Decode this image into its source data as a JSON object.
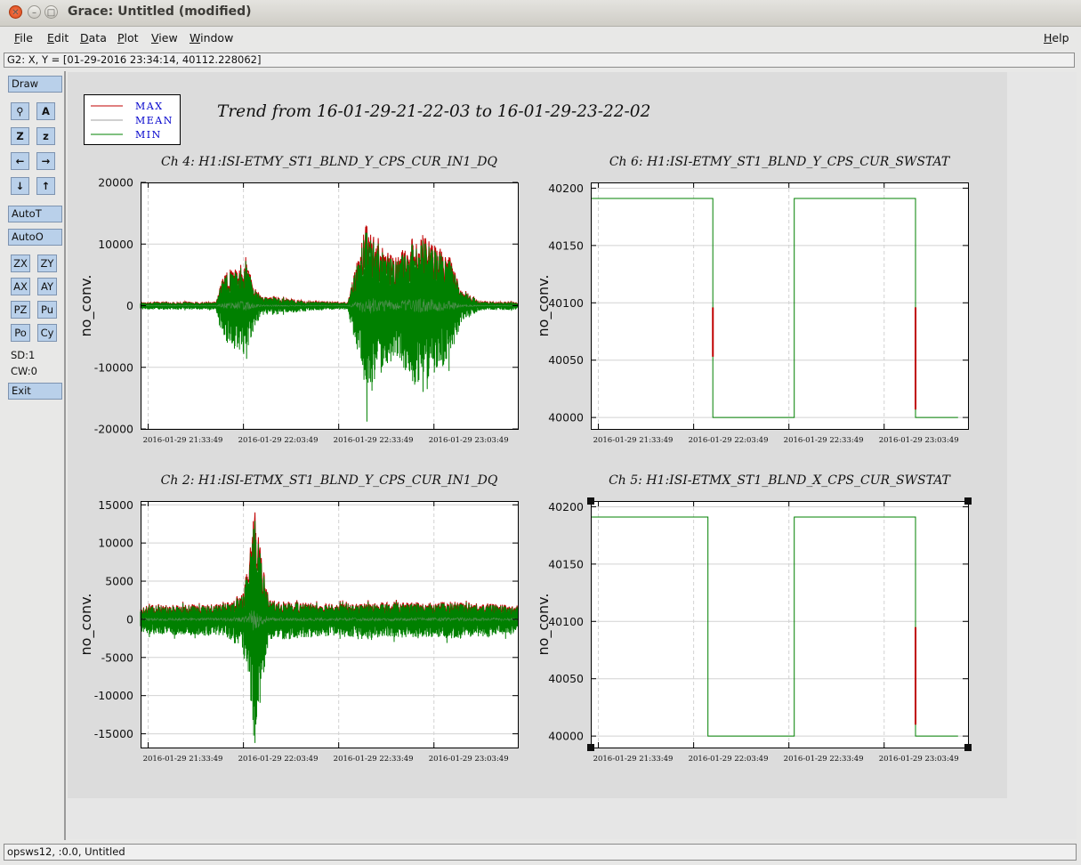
{
  "window": {
    "title": "Grace: Untitled (modified)",
    "close_glyph": "✕",
    "min_glyph": "–",
    "max_glyph": "□"
  },
  "menubar": {
    "items": [
      "File",
      "Edit",
      "Data",
      "Plot",
      "View",
      "Window"
    ],
    "help": "Help"
  },
  "locator": {
    "text": "G2: X, Y = [01-29-2016 23:34:14, 40112.228062]"
  },
  "toolbar": {
    "draw": "Draw",
    "icons": [
      "magnifier-icon",
      "text-zoom-icon",
      "zoom-z-icon",
      "zoom-z-small-icon",
      "arrow-left-icon",
      "arrow-right-icon",
      "arrow-down-icon",
      "arrow-up-icon"
    ],
    "icon_glyphs": [
      "⚲",
      "A",
      "Z",
      "z",
      "←",
      "→",
      "↓",
      "↑"
    ],
    "autot": "AutoT",
    "autoo": "AutoO",
    "small": [
      "ZX",
      "ZY",
      "AX",
      "AY",
      "PZ",
      "Pu",
      "Po",
      "Cy"
    ],
    "sd": "SD:1",
    "cw": "CW:0",
    "exit": "Exit"
  },
  "status": {
    "text": "opsws12, :0.0, Untitled"
  },
  "page": {
    "main_title": "Trend from 16-01-29-21-22-03 to 16-01-29-23-22-02",
    "legend": [
      {
        "label": "MAX",
        "color": "#c00000"
      },
      {
        "label": "MEAN",
        "color": "#a0a0a0"
      },
      {
        "label": "MIN",
        "color": "#008000"
      }
    ],
    "label_color": "#0000cc"
  },
  "chart_data": [
    {
      "type": "line",
      "title": "Ch 4: H1:ISI-ETMY_ST1_BLND_Y_CPS_CUR_IN1_DQ",
      "ylabel": "no_conv.",
      "ylim": [
        -20000,
        20000
      ],
      "yticks": [
        -20000,
        -10000,
        0,
        10000,
        20000
      ],
      "xtick_labels": [
        "2016-01-29 21:33:49",
        "2016-01-29 22:03:49",
        "2016-01-29 22:33:49",
        "2016-01-29 23:03:49"
      ],
      "grid": true,
      "profile": [
        [
          0,
          600
        ],
        [
          0.2,
          600
        ],
        [
          0.22,
          5000
        ],
        [
          0.28,
          8000
        ],
        [
          0.3,
          3500
        ],
        [
          0.32,
          1500
        ],
        [
          0.36,
          1300
        ],
        [
          0.46,
          700
        ],
        [
          0.55,
          600
        ],
        [
          0.56,
          3500
        ],
        [
          0.6,
          14000
        ],
        [
          0.64,
          10000
        ],
        [
          0.68,
          8000
        ],
        [
          0.73,
          12000
        ],
        [
          0.78,
          10000
        ],
        [
          0.82,
          8000
        ],
        [
          0.85,
          2500
        ],
        [
          0.9,
          700
        ],
        [
          1,
          600
        ]
      ],
      "series": [
        {
          "name": "MAX",
          "color": "#c00000"
        },
        {
          "name": "MEAN",
          "color": "#a0a0a0"
        },
        {
          "name": "MIN",
          "color": "#008000"
        }
      ]
    },
    {
      "type": "line",
      "title": "Ch 6: H1:ISI-ETMY_ST1_BLND_Y_CPS_CUR_SWSTAT",
      "ylabel": "no_conv.",
      "ylim": [
        39990,
        40205
      ],
      "yticks": [
        40000,
        40050,
        40100,
        40150,
        40200
      ],
      "xtick_labels": [
        "2016-01-29 21:33:49",
        "2016-01-29 22:03:49",
        "2016-01-29 22:33:49",
        "2016-01-29 23:03:49"
      ],
      "grid": true,
      "steps": [
        [
          0,
          40191
        ],
        [
          0.3237,
          40000
        ],
        [
          0.5395,
          40191
        ],
        [
          0.8609,
          40000
        ],
        [
          0.9736,
          40000
        ]
      ],
      "spikes": [
        [
          0.3237,
          40096,
          40053
        ],
        [
          0.8609,
          40096,
          40007
        ]
      ],
      "series": [
        {
          "name": "MAX",
          "color": "#c00000"
        },
        {
          "name": "MEAN",
          "color": "#a0a0a0"
        },
        {
          "name": "MIN",
          "color": "#008000"
        }
      ]
    },
    {
      "type": "line",
      "title": "Ch 2: H1:ISI-ETMX_ST1_BLND_Y_CPS_CUR_IN1_DQ",
      "ylabel": "no_conv.",
      "ylim": [
        -16800,
        15500
      ],
      "yticks": [
        -15000,
        -10000,
        -5000,
        0,
        5000,
        10000,
        15000
      ],
      "xtick_labels": [
        "2016-01-29 21:33:49",
        "2016-01-29 22:03:49",
        "2016-01-29 22:33:49",
        "2016-01-29 23:03:49"
      ],
      "grid": true,
      "profile": [
        [
          0,
          1800
        ],
        [
          0.22,
          2000
        ],
        [
          0.27,
          3500
        ],
        [
          0.29,
          9000
        ],
        [
          0.3,
          15000
        ],
        [
          0.32,
          9000
        ],
        [
          0.34,
          2500
        ],
        [
          0.5,
          2000
        ],
        [
          0.6,
          2200
        ],
        [
          0.85,
          2300
        ],
        [
          1,
          1800
        ]
      ],
      "series": [
        {
          "name": "MAX",
          "color": "#c00000"
        },
        {
          "name": "MEAN",
          "color": "#a0a0a0"
        },
        {
          "name": "MIN",
          "color": "#008000"
        }
      ]
    },
    {
      "type": "line",
      "title": "Ch 5: H1:ISI-ETMX_ST1_BLND_X_CPS_CUR_SWSTAT",
      "ylabel": "no_conv.",
      "ylim": [
        39990,
        40205
      ],
      "yticks": [
        40000,
        40050,
        40100,
        40150,
        40200
      ],
      "xtick_labels": [
        "2016-01-29 21:33:49",
        "2016-01-29 22:03:49",
        "2016-01-29 22:33:49",
        "2016-01-29 23:03:49"
      ],
      "grid": true,
      "steps": [
        [
          0,
          40191
        ],
        [
          0.3105,
          40000
        ],
        [
          0.5395,
          40191
        ],
        [
          0.8609,
          40000
        ],
        [
          0.9736,
          40000
        ]
      ],
      "spikes": [
        [
          0.8609,
          40095,
          40010
        ]
      ],
      "series": [
        {
          "name": "MAX",
          "color": "#c00000"
        },
        {
          "name": "MEAN",
          "color": "#a0a0a0"
        },
        {
          "name": "MIN",
          "color": "#008000"
        }
      ]
    }
  ]
}
